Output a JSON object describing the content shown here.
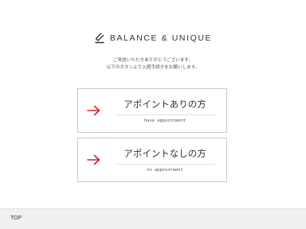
{
  "brand": {
    "name": "BALANCE & UNIQUE",
    "logo_icon": "brand-logo-icon"
  },
  "intro": {
    "line1": "ご来訪いただきありがとうございます。",
    "line2": "以下のボタンより入館手続きをお願いします。"
  },
  "choices": [
    {
      "title": "アポイントありの方",
      "subtitle": "have appointment",
      "icon": "arrow-right-icon"
    },
    {
      "title": "アポイントなしの方",
      "subtitle": "no appointment",
      "icon": "arrow-right-icon"
    }
  ],
  "footer": {
    "top_label": "TOP"
  },
  "colors": {
    "accent": "#d0202c",
    "border": "#c8c8c8",
    "footer_bg": "#f0f0f0"
  }
}
